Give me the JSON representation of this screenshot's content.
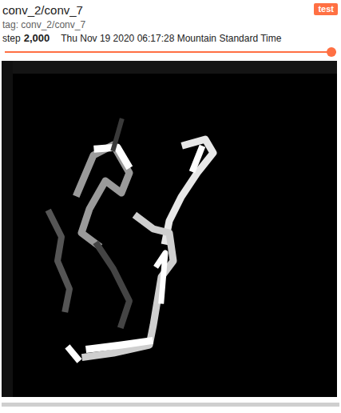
{
  "card": {
    "title": "conv_2/conv_7",
    "run": {
      "label": "test",
      "color": "#ff7043"
    },
    "tag": "tag: conv_2/conv_7",
    "step_label": "step",
    "step": "2,000",
    "time": "Thu Nov 19 2020 06:17:28 Mountain Standard Time"
  },
  "slider": {
    "level": 1
  }
}
